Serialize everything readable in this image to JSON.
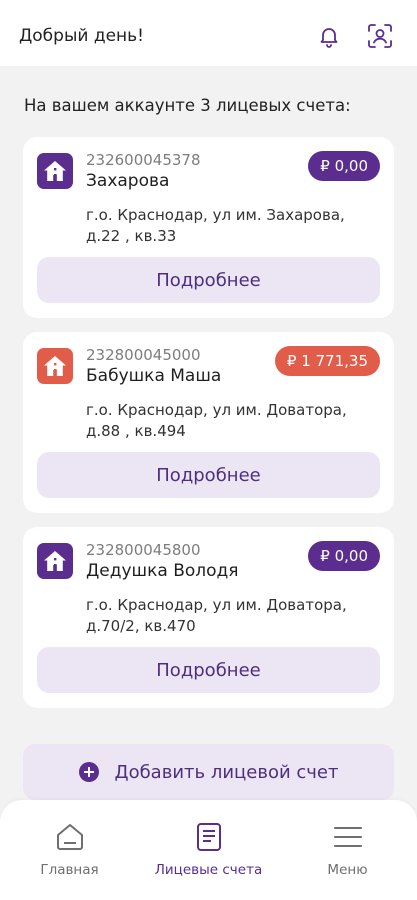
{
  "header": {
    "greeting": "Добрый день!",
    "bell_icon": "bell-icon",
    "profile_scan_icon": "profile-scan-icon"
  },
  "summary_text": "На вашем аккаунте 3 лицевых счета:",
  "accounts": [
    {
      "number": "232600045378",
      "name": "Захарова",
      "balance": "₽ 0,00",
      "address": "г.о. Краснодар, ул им. Захарова, д.22 , кв.33",
      "details_label": "Подробнее",
      "color": "#5b2d8f"
    },
    {
      "number": "232800045000",
      "name": "Бабушка Маша",
      "balance": "₽ 1 771,35",
      "address": "г.о. Краснодар, ул им. Доватора, д.88 , кв.494",
      "details_label": "Подробнее",
      "color": "#e25c4a"
    },
    {
      "number": "232800045800",
      "name": "Дедушка Володя",
      "balance": "₽ 0,00",
      "address": "г.о. Краснодар, ул им. Доватора, д.70/2, кв.470",
      "details_label": "Подробнее",
      "color": "#5b2d8f"
    }
  ],
  "add_account": {
    "label": "Добавить лицевой счет",
    "icon": "plus-circle-icon"
  },
  "bottom_nav": {
    "items": [
      {
        "label": "Главная",
        "icon": "home-icon",
        "active": false
      },
      {
        "label": "Лицевые счета",
        "icon": "document-icon",
        "active": true
      },
      {
        "label": "Меню",
        "icon": "menu-icon",
        "active": false
      }
    ]
  },
  "colors": {
    "accent": "#5b2d8f",
    "debt": "#e25c4a",
    "button_bg": "#ece6f4",
    "background": "#f3f2f3"
  }
}
